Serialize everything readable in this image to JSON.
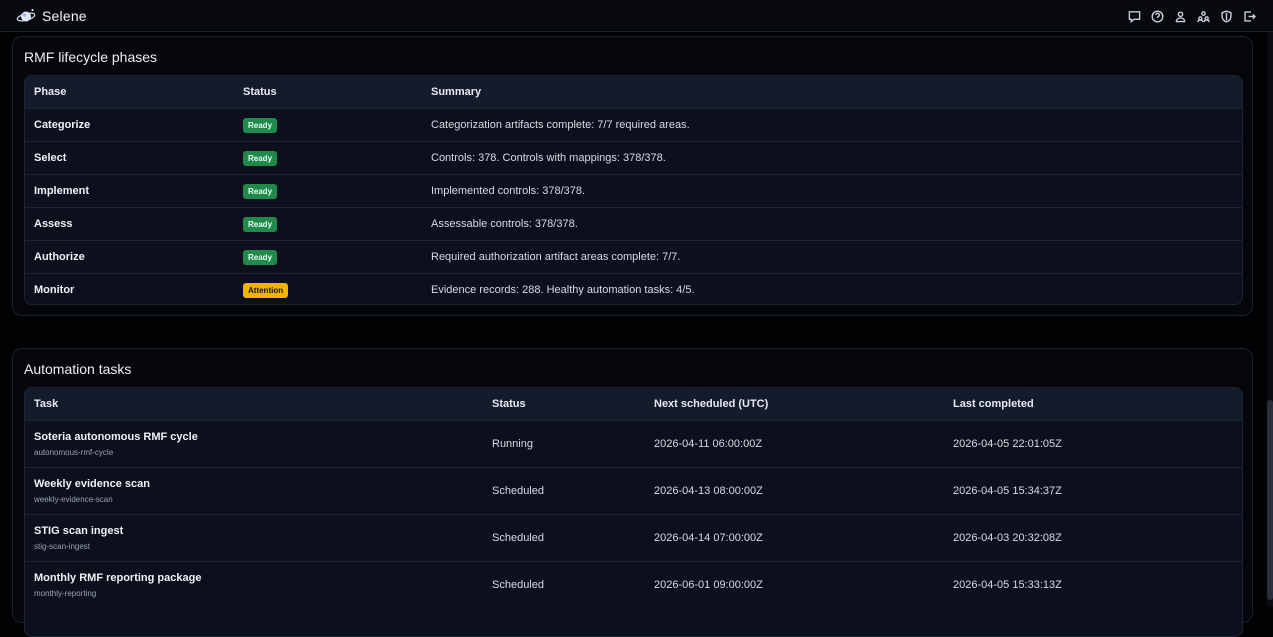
{
  "app": {
    "title": "Selene"
  },
  "toolbar": {
    "icons": [
      "chat-icon",
      "help-icon",
      "user-icon",
      "users-icon",
      "shield-icon",
      "logout-icon"
    ]
  },
  "rmf": {
    "title": "RMF lifecycle phases",
    "columns": [
      "Phase",
      "Status",
      "Summary"
    ],
    "rows": [
      {
        "phase": "Categorize",
        "status": "Ready",
        "summary": "Categorization artifacts complete: 7/7 required areas."
      },
      {
        "phase": "Select",
        "status": "Ready",
        "summary": "Controls: 378. Controls with mappings: 378/378."
      },
      {
        "phase": "Implement",
        "status": "Ready",
        "summary": "Implemented controls: 378/378."
      },
      {
        "phase": "Assess",
        "status": "Ready",
        "summary": "Assessable controls: 378/378."
      },
      {
        "phase": "Authorize",
        "status": "Ready",
        "summary": "Required authorization artifact areas complete: 7/7."
      },
      {
        "phase": "Monitor",
        "status": "Attention",
        "summary": "Evidence records: 288. Healthy automation tasks: 4/5."
      }
    ]
  },
  "automation": {
    "title": "Automation tasks",
    "columns": [
      "Task",
      "Status",
      "Next scheduled (UTC)",
      "Last completed"
    ],
    "rows": [
      {
        "name": "Soteria autonomous RMF cycle",
        "id": "autonomous-rmf-cycle",
        "status": "Running",
        "next": "2026-04-11 06:00:00Z",
        "last": "2026-04-05 22:01:05Z"
      },
      {
        "name": "Weekly evidence scan",
        "id": "weekly-evidence-scan",
        "status": "Scheduled",
        "next": "2026-04-13 08:00:00Z",
        "last": "2026-04-05 15:34:37Z"
      },
      {
        "name": "STIG scan ingest",
        "id": "stig-scan-ingest",
        "status": "Scheduled",
        "next": "2026-04-14 07:00:00Z",
        "last": "2026-04-03 20:32:08Z"
      },
      {
        "name": "Monthly RMF reporting package",
        "id": "monthly-reporting",
        "status": "Scheduled",
        "next": "2026-06-01 09:00:00Z",
        "last": "2026-04-05 15:33:13Z"
      }
    ]
  }
}
